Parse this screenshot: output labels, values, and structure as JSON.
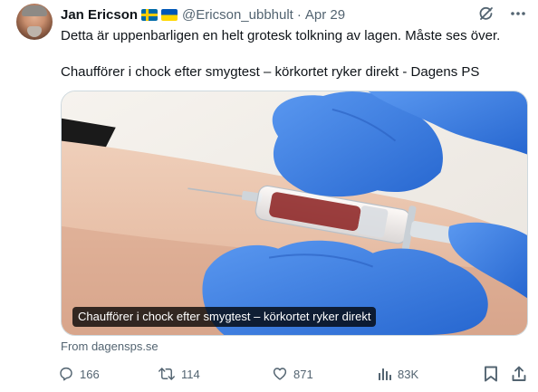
{
  "author": {
    "name": "Jan Ericson",
    "flags": [
      "swedish-flag",
      "ukrainian-flag"
    ],
    "handle": "@Ericson_ubbhult",
    "separator": "·",
    "date": "Apr 29"
  },
  "tweet": {
    "text": "Detta är uppenbarligen en helt grotesk tolkning av lagen. Måste ses över.",
    "link_title": "Chaufförer i chock efter smygtest – körkortet ryker direkt - Dagens PS"
  },
  "card": {
    "image_icon": "syringe-in-arm-photo",
    "title": "Chaufförer i chock efter smygtest – körkortet ryker direkt",
    "source": "From dagensps.se"
  },
  "actions": {
    "replies": "166",
    "reposts": "114",
    "likes": "871",
    "views": "83K"
  },
  "colors": {
    "text": "#0f1419",
    "muted": "#536471",
    "glove": "#3b7fe8",
    "border": "#cfd9de"
  }
}
